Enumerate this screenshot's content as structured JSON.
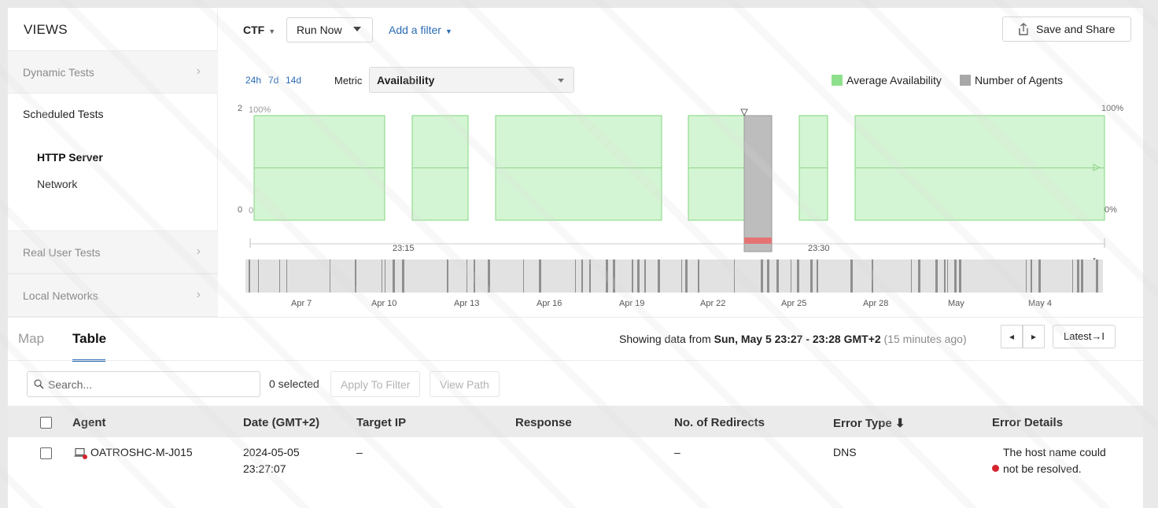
{
  "sidebar": {
    "title": "VIEWS",
    "sections": [
      {
        "label": "Dynamic Tests"
      },
      {
        "label": "Real User Tests"
      },
      {
        "label": "Local Networks"
      }
    ],
    "scheduled_label": "Scheduled Tests",
    "scheduled_items": [
      {
        "label": "HTTP Server",
        "active": true
      },
      {
        "label": "Network",
        "active": false
      }
    ]
  },
  "toolbar": {
    "account": "CTF",
    "run_now": "Run Now",
    "add_filter": "Add a filter",
    "save_share": "Save and Share"
  },
  "timeline": {
    "ranges": [
      "24h",
      "7d",
      "14d"
    ],
    "metric_label": "Metric",
    "metric_value": "Availability",
    "legend": [
      {
        "label": "Average Availability",
        "color": "#8fe08c"
      },
      {
        "label": "Number of Agents",
        "color": "#a8a8a8"
      }
    ],
    "left_axis": [
      "2",
      "0"
    ],
    "right_axis": [
      "100%",
      "0%"
    ],
    "inner_axis": [
      "100%",
      "0%"
    ],
    "time_labels": [
      "23:15",
      "23:30"
    ],
    "overview_labels": [
      "Apr 7",
      "Apr 10",
      "Apr 13",
      "Apr 16",
      "Apr 19",
      "Apr 22",
      "Apr 25",
      "Apr 28",
      "May",
      "May 4"
    ]
  },
  "chart_data": {
    "type": "bar",
    "series": [
      {
        "name": "Average Availability",
        "values": [
          100,
          100,
          100,
          100,
          0,
          100,
          100
        ]
      },
      {
        "name": "Number of Agents",
        "values": [
          0,
          0,
          0,
          0,
          2,
          0,
          0
        ]
      }
    ],
    "ylim_left": [
      0,
      2
    ],
    "ylim_right": [
      0,
      100
    ]
  },
  "results": {
    "tabs": [
      {
        "label": "Map",
        "active": false
      },
      {
        "label": "Table",
        "active": true
      }
    ],
    "showing_prefix": "Showing data from ",
    "showing_range": "Sun, May 5 23:27 - 23:28 GMT+2",
    "showing_ago": " (15 minutes ago)",
    "prev": "◂",
    "next": "▸",
    "latest": "Latest→I",
    "search_placeholder": "Search...",
    "selected_count": "0 selected",
    "apply_filter": "Apply To Filter",
    "view_path": "View Path",
    "columns": [
      "Agent",
      "Date (GMT+2)",
      "Target IP",
      "Response",
      "No. of Redirects",
      "Error Type ⬇",
      "Error Details"
    ],
    "rows": [
      {
        "agent": "OATROSHC-M-J015",
        "date_line1": "2024-05-05",
        "date_line2": "23:27:07",
        "target_ip": "–",
        "response": "",
        "redirects": "–",
        "error_type": "DNS",
        "error_line1": "The host name could",
        "error_line2": "not be resolved."
      }
    ]
  }
}
